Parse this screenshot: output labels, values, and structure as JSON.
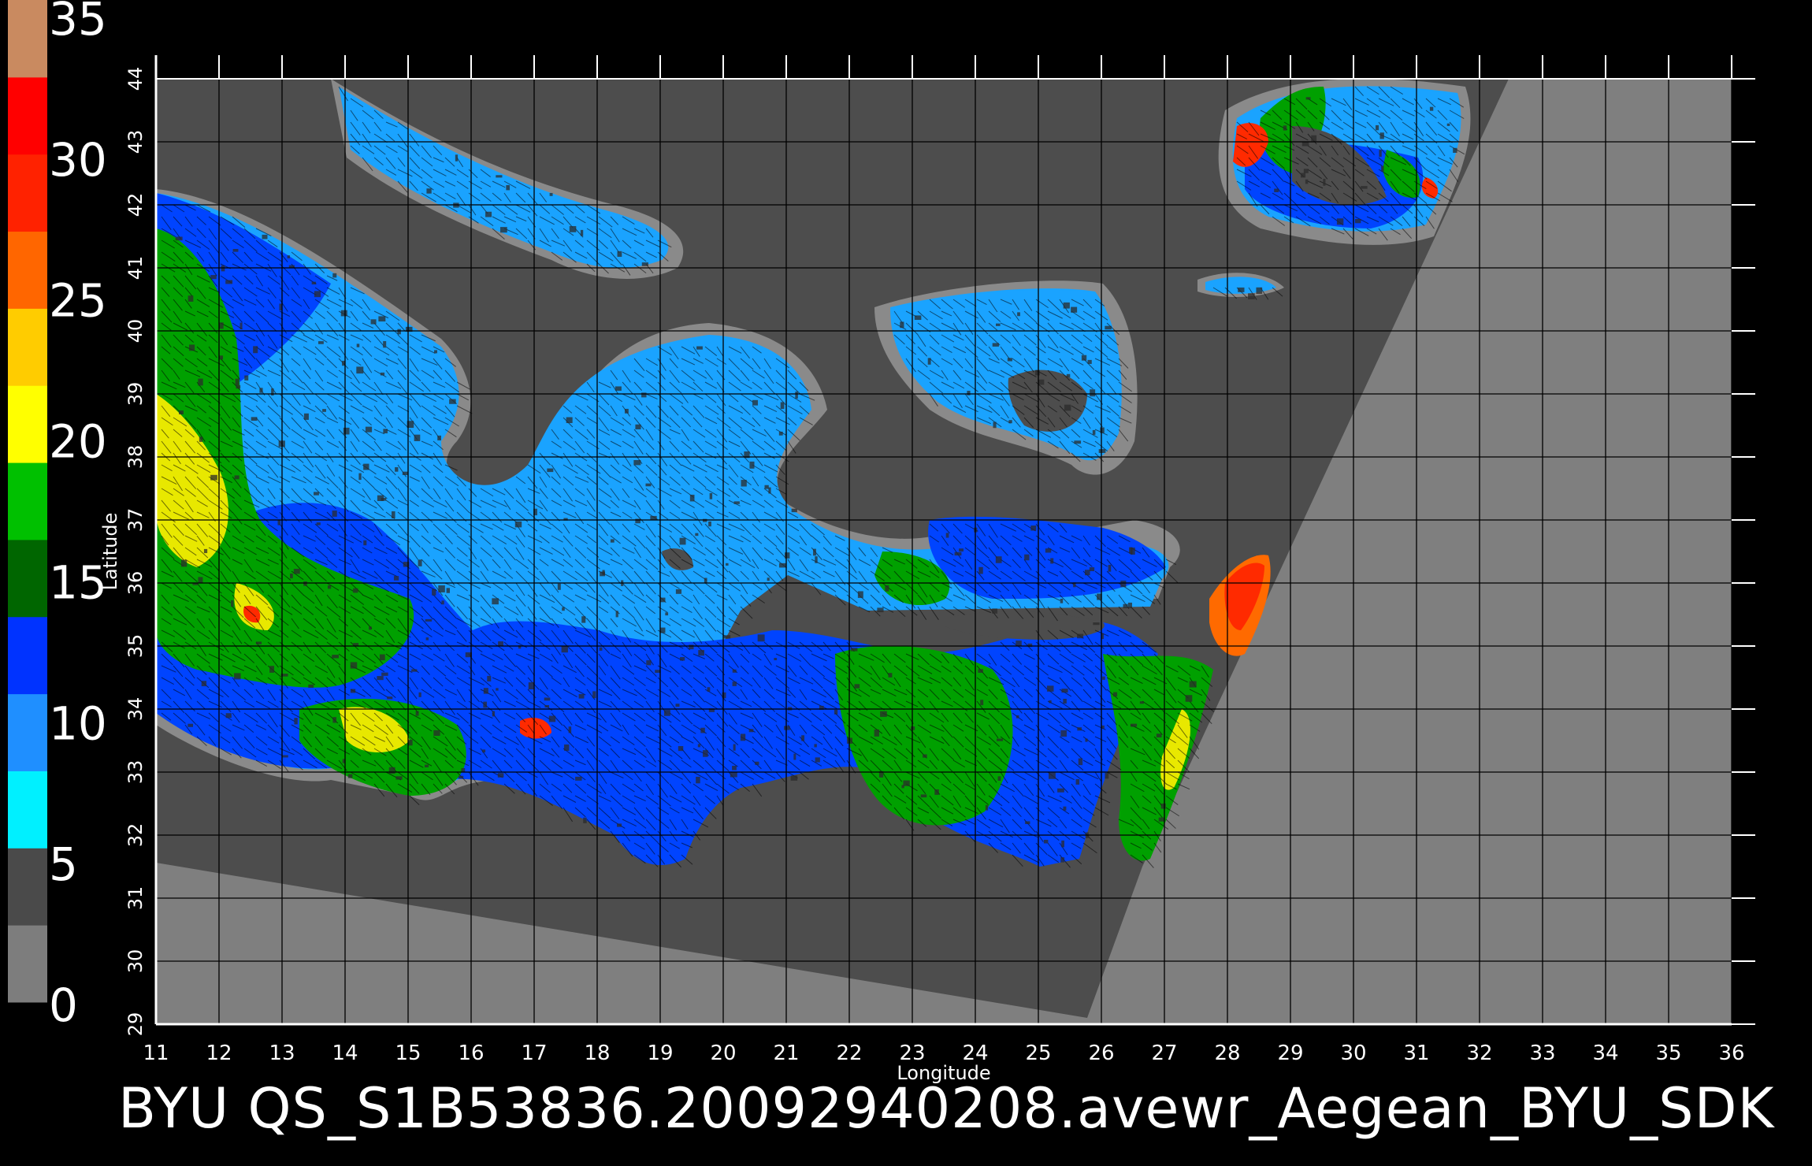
{
  "colorbar": {
    "ticks": [
      "0",
      "5",
      "10",
      "15",
      "20",
      "25",
      "30",
      "35"
    ],
    "bands": [
      {
        "color": "#7d7d7d"
      },
      {
        "color": "#4a4a4a"
      },
      {
        "color": "#00f0ff"
      },
      {
        "color": "#1f8fff"
      },
      {
        "color": "#0033ff"
      },
      {
        "color": "#006600"
      },
      {
        "color": "#00c000"
      },
      {
        "color": "#ffff00"
      },
      {
        "color": "#ffcc00"
      },
      {
        "color": "#ff6600"
      },
      {
        "color": "#ff2200"
      },
      {
        "color": "#ff0000"
      },
      {
        "color": "#c98a60"
      }
    ]
  },
  "map": {
    "x_ticks": [
      "11",
      "12",
      "13",
      "14",
      "15",
      "16",
      "17",
      "18",
      "19",
      "20",
      "21",
      "22",
      "23",
      "24",
      "25",
      "26",
      "27",
      "28",
      "29",
      "30",
      "31",
      "32",
      "33",
      "34",
      "35",
      "36"
    ],
    "y_ticks": [
      "29",
      "30",
      "31",
      "32",
      "33",
      "34",
      "35",
      "36",
      "37",
      "38",
      "39",
      "40",
      "41",
      "42",
      "43",
      "44"
    ],
    "xlabel": "Longitude",
    "ylabel": "Latitude",
    "colors": {
      "background": "#000000",
      "no_data": "#7f7f7f",
      "land": "#4d4d4d",
      "coast_halo": "#8a8a8a",
      "wind_light": "#1aa3ff",
      "wind_medium": "#0040ff",
      "wind_strong": "#00a000",
      "wind_gale": "#e8e800",
      "wind_storm": "#ff2a00",
      "grid": "#000000"
    }
  },
  "footer": {
    "caption": "BYU  QS_S1B53836.20092940208.avewr_Aegean_BYU_SDK"
  }
}
